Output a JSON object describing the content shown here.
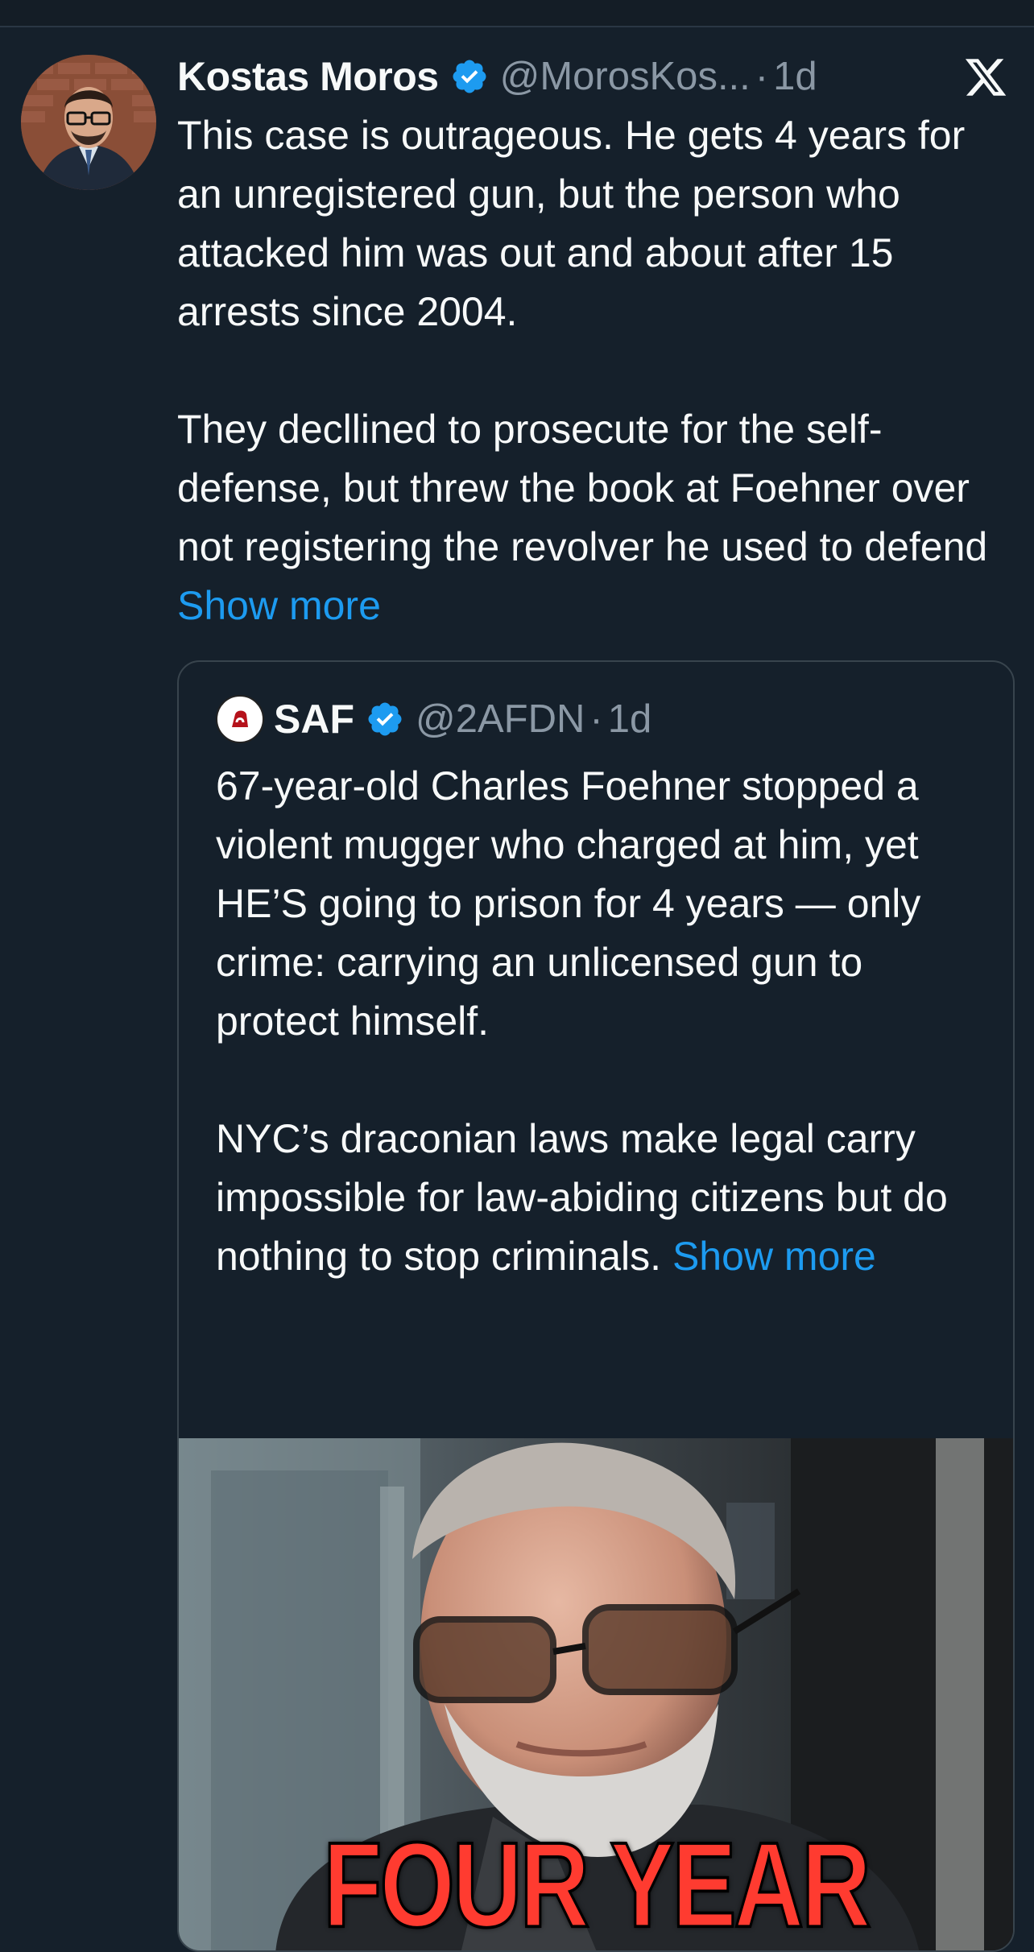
{
  "tweet": {
    "author": {
      "display_name": "Kostas Moros",
      "handle": "@MorosKos...",
      "verified": true,
      "avatar": "profile-photo"
    },
    "separator": "·",
    "timestamp": "1d",
    "text_paragraphs": [
      "This case is outrageous. He gets 4 years for an unregistered gun, but the person who attacked him was out and about after 15 arrests since 2004.",
      "They decllined to prosecute for the self-defense, but threw the book at Foehner over not registering the revolver he used to defend "
    ],
    "show_more_label": "Show more",
    "platform_icon": "x-logo-icon"
  },
  "quoted_tweet": {
    "author": {
      "display_name": "SAF",
      "handle": "@2AFDN",
      "verified": true,
      "avatar": "saf-logo"
    },
    "separator": "·",
    "timestamp": "1d",
    "text_paragraphs": [
      "67-year-old Charles Foehner stopped a violent mugger who charged at him, yet HE’S going to prison for 4 years — only crime: carrying an unlicensed gun to protect himself.",
      "NYC’s draconian laws make legal carry impossible for law-abiding citizens but do nothing to stop criminals. "
    ],
    "show_more_label": "Show more",
    "media": {
      "kind": "photo",
      "caption_text": "FOUR YEAR"
    }
  },
  "colors": {
    "background": "#15202b",
    "text_primary": "#f7f9f9",
    "text_secondary": "#8b98a5",
    "link": "#1d9bf0",
    "verified_badge": "#1d9bf0",
    "border": "#38444d",
    "caption_red": "#ff3b30"
  }
}
